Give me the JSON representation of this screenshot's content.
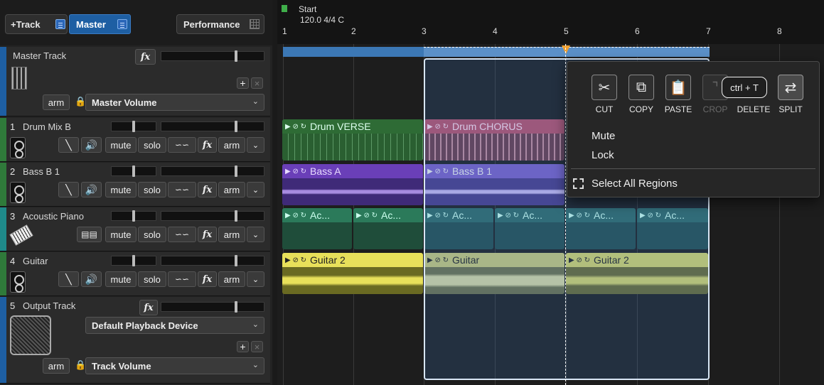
{
  "toolbar": {
    "add_track": "+Track",
    "master": "Master",
    "performance": "Performance"
  },
  "master_track": {
    "name": "Master Track",
    "fx": "fx",
    "arm": "arm",
    "volume_select": "Master Volume",
    "add": "+",
    "close": "×"
  },
  "tracks": [
    {
      "num": "1",
      "name": "Drum Mix B",
      "color": "#2f7a3a"
    },
    {
      "num": "2",
      "name": "Bass B 1",
      "color": "#2f7a3a"
    },
    {
      "num": "3",
      "name": "Acoustic Piano",
      "color": "#1f8a8a"
    },
    {
      "num": "4",
      "name": "Guitar",
      "color": "#2f7a3a"
    }
  ],
  "track_controls": {
    "mute": "mute",
    "solo": "solo",
    "fx": "fx",
    "arm": "arm"
  },
  "output_track": {
    "num": "5",
    "name": "Output Track",
    "fx": "fx",
    "device_select": "Default Playback Device",
    "arm": "arm",
    "volume_select": "Track Volume",
    "add": "+",
    "close": "×"
  },
  "ruler": {
    "start_label": "Start",
    "tempo": "120.0 4/4 C",
    "bars": [
      "1",
      "2",
      "3",
      "4",
      "5",
      "6",
      "7",
      "8"
    ]
  },
  "regions": {
    "drum_verse": "Drum VERSE",
    "drum_chorus": "Drum CHORUS",
    "bass_a": "Bass A",
    "bass_b1": "Bass B 1",
    "ac": "Ac...",
    "guitar2": "Guitar 2",
    "guitar": "Guitar",
    "guitar2_b": "Guitar 2"
  },
  "context_menu": {
    "tools": [
      "CUT",
      "COPY",
      "PASTE",
      "CROP",
      "DELETE",
      "SPLIT"
    ],
    "mute": "Mute",
    "lock": "Lock",
    "select_all": "Select All Regions",
    "tooltip": "ctrl + T"
  },
  "colors": {
    "accent_blue": "#1e5fa3",
    "drum": "#2e6b35",
    "drum_chorus": "#b8506a",
    "bass": "#6a3fb8",
    "piano": "#2b7a5a",
    "guitar": "#e8e05a"
  }
}
